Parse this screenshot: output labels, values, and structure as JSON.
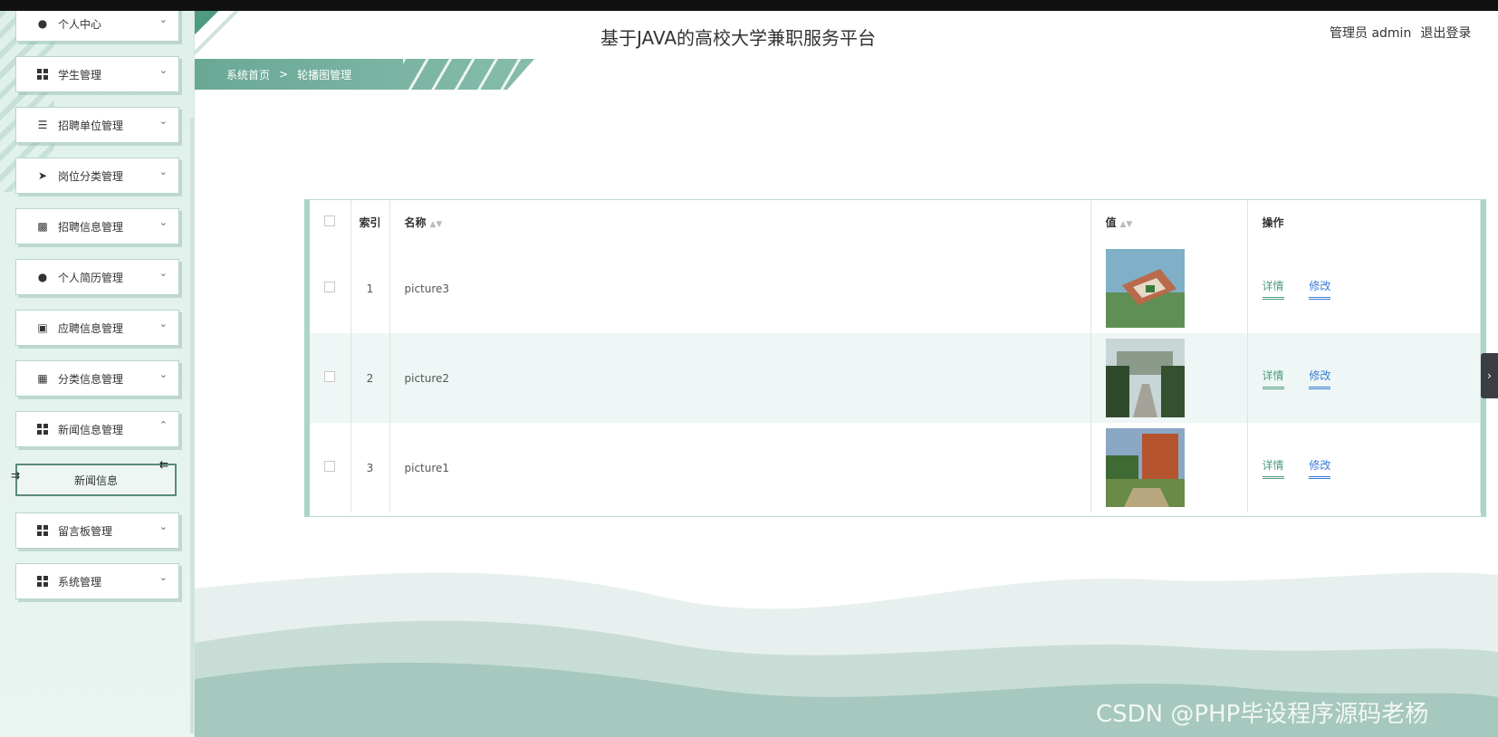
{
  "header": {
    "title": "基于JAVA的高校大学兼职服务平台",
    "user": "管理员 admin",
    "logout": "退出登录"
  },
  "breadcrumb": {
    "home": "系统首页",
    "separator": ">",
    "current": "轮播图管理"
  },
  "sidebar": {
    "items": [
      {
        "label": "个人中心",
        "icon": "user-icon"
      },
      {
        "label": "学生管理",
        "icon": "grid-icon"
      },
      {
        "label": "招聘单位管理",
        "icon": "list-icon"
      },
      {
        "label": "岗位分类管理",
        "icon": "send-icon"
      },
      {
        "label": "招聘信息管理",
        "icon": "clipboard-icon"
      },
      {
        "label": "个人简历管理",
        "icon": "user-icon"
      },
      {
        "label": "应聘信息管理",
        "icon": "briefcase-icon"
      },
      {
        "label": "分类信息管理",
        "icon": "wallet-icon"
      },
      {
        "label": "新闻信息管理",
        "icon": "grid-icon"
      },
      {
        "label": "留言板管理",
        "icon": "grid-icon"
      },
      {
        "label": "系统管理",
        "icon": "grid-icon"
      }
    ],
    "submenu": {
      "label": "新闻信息"
    }
  },
  "table": {
    "headers": {
      "index": "索引",
      "name": "名称",
      "value": "值",
      "actions": "操作"
    },
    "rows": [
      {
        "index": "1",
        "name": "picture3",
        "detail": "详情",
        "edit": "修改"
      },
      {
        "index": "2",
        "name": "picture2",
        "detail": "详情",
        "edit": "修改"
      },
      {
        "index": "3",
        "name": "picture1",
        "detail": "详情",
        "edit": "修改"
      }
    ]
  },
  "watermark": "CSDN @PHP毕设程序源码老杨",
  "colors": {
    "accent": "#4f9a82",
    "link": "#3a7bd5",
    "row_alt": "#eef7f5"
  }
}
